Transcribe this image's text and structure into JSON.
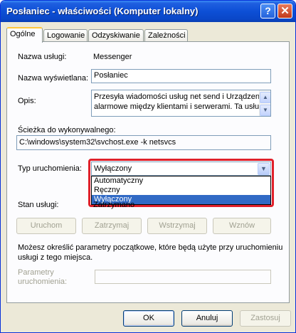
{
  "window": {
    "title": "Posłaniec - właściwości (Komputer lokalny)",
    "help_button": "?",
    "close_button": "✕"
  },
  "tabs": [
    "Ogólne",
    "Logowanie",
    "Odzyskiwanie",
    "Zależności"
  ],
  "general": {
    "service_name_label": "Nazwa usługi:",
    "service_name_value": "Messenger",
    "display_name_label": "Nazwa wyświetlana:",
    "display_name_value": "Posłaniec",
    "description_label": "Opis:",
    "description_line1": "Przesyła wiadomości usług net send i Urządzenie",
    "description_line2": "alarmowe między klientami i serwerami. Ta usługa",
    "path_label": "Ścieżka do wykonywalnego:",
    "path_value": "C:\\windows\\system32\\svchost.exe -k netsvcs",
    "startup_type_label": "Typ uruchomienia:",
    "startup_type_value": "Wyłączony",
    "startup_options": [
      "Automatyczny",
      "Ręczny",
      "Wyłączony"
    ],
    "status_label": "Stan usługi:",
    "status_value": "Zatrzymano",
    "start_button": "Uruchom",
    "stop_button": "Zatrzymaj",
    "pause_button": "Wstrzymaj",
    "resume_button": "Wznów",
    "params_info": "Możesz określić parametry początkowe, które będą użyte przy uruchomieniu usługi z tego miejsca.",
    "params_info_line1": "Możesz określić parametry początkowe, które będą użyte przy uruchomieniu",
    "params_info_line2": "usługi z tego miejsca.",
    "params_label_line1": "Parametry",
    "params_label_line2": "uruchomienia:",
    "params_value": ""
  },
  "footer": {
    "ok_button": "OK",
    "cancel_button": "Anuluj",
    "apply_button": "Zastosuj"
  },
  "colors": {
    "titlebar": "#0a47c8",
    "highlight": "#e0202a",
    "selected_option": "#316ac5"
  }
}
